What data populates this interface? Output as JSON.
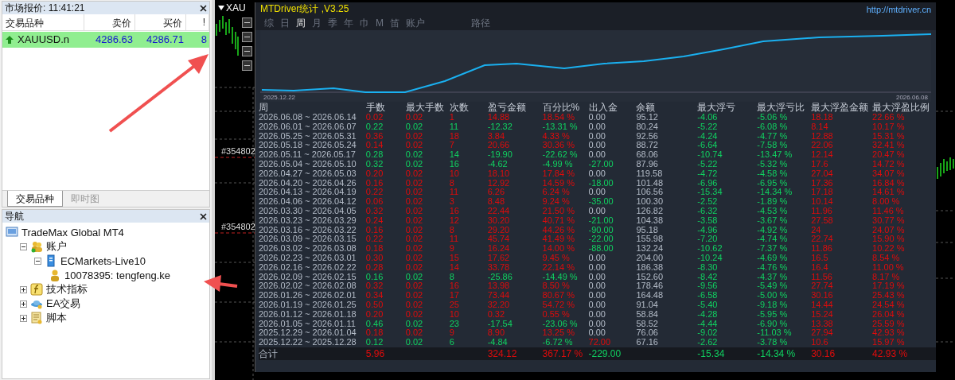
{
  "market_watch": {
    "title": "市场报价: 11:41:21",
    "columns": [
      "交易品种",
      "卖价",
      "买价",
      "!"
    ],
    "rows": [
      {
        "symbol": "XAUUSD.n",
        "bid": "4286.63",
        "ask": "4286.71",
        "spread": "8",
        "selected": true
      }
    ],
    "tabs": [
      {
        "label": "交易品种",
        "selected": true
      },
      {
        "label": "即时图",
        "selected": false
      }
    ]
  },
  "navigator": {
    "title": "导航",
    "tree": [
      {
        "label": "TradeMax Global MT4",
        "kind": "terminal",
        "children": [
          {
            "label": "账户",
            "kind": "accounts",
            "expanded": true,
            "children": [
              {
                "label": "ECMarkets-Live10",
                "kind": "server",
                "expanded": true,
                "children": [
                  {
                    "label": "10078395: tengfeng.ke",
                    "kind": "account"
                  }
                ]
              }
            ]
          },
          {
            "label": "技术指标",
            "kind": "indicators",
            "expanded": false
          },
          {
            "label": "EA交易",
            "kind": "experts",
            "expanded": false
          },
          {
            "label": "脚本",
            "kind": "scripts",
            "expanded": false
          }
        ]
      }
    ]
  },
  "chart": {
    "symbol": "XAU",
    "order_labels": [
      "#354802",
      "#354802"
    ]
  },
  "stats": {
    "title": "MTDriver统计 ,V3.25",
    "link": "http://mtdriver.cn",
    "tabs": [
      {
        "label": "综",
        "selected": false
      },
      {
        "label": "日",
        "selected": false
      },
      {
        "label": "周",
        "selected": true
      },
      {
        "label": "月",
        "selected": false
      },
      {
        "label": "季",
        "selected": false
      },
      {
        "label": "年",
        "selected": false
      },
      {
        "label": "巾",
        "selected": false
      },
      {
        "label": "M",
        "selected": false
      },
      {
        "label": "笛",
        "selected": false
      },
      {
        "label": "账户",
        "selected": false
      },
      {
        "label": "路径",
        "selected": false
      }
    ],
    "equity_start": "2025.12.22",
    "equity_end": "2026.06.08",
    "columns": [
      "周",
      "手数",
      "最大手数",
      "次数",
      "盈亏金额",
      "百分比%",
      "出入金",
      "余额",
      "最大浮亏",
      "最大浮亏比",
      "最大浮盈金额",
      "最大浮盈比例"
    ],
    "rows": [
      {
        "cells": [
          "2026.06.08 ~ 2026.06.14",
          "0.02",
          "0.02",
          "1",
          "14.88",
          "18.54 %",
          "0.00",
          "95.12",
          "-4.06",
          "-5.06 %",
          "18.18",
          "22.66 %"
        ],
        "profit": true,
        "withdrawal": false,
        "deposit": false
      },
      {
        "cells": [
          "2026.06.01 ~ 2026.06.07",
          "0.22",
          "0.02",
          "11",
          "-12.32",
          "-13.31 %",
          "0.00",
          "80.24",
          "-5.22",
          "-6.08 %",
          "8.14",
          "10.17 %"
        ],
        "profit": false,
        "withdrawal": false,
        "deposit": false
      },
      {
        "cells": [
          "2026.05.25 ~ 2026.05.31",
          "0.36",
          "0.02",
          "18",
          "3.84",
          "4.33 %",
          "0.00",
          "92.56",
          "-4.24",
          "-4.77 %",
          "12.88",
          "15.31 %"
        ],
        "profit": true,
        "withdrawal": false,
        "deposit": false
      },
      {
        "cells": [
          "2026.05.18 ~ 2026.05.24",
          "0.14",
          "0.02",
          "7",
          "20.66",
          "30.36 %",
          "0.00",
          "88.72",
          "-6.64",
          "-7.58 %",
          "22.06",
          "32.41 %"
        ],
        "profit": true,
        "withdrawal": false,
        "deposit": false
      },
      {
        "cells": [
          "2026.05.11 ~ 2026.05.17",
          "0.28",
          "0.02",
          "14",
          "-19.90",
          "-22.62 %",
          "0.00",
          "68.06",
          "-10.74",
          "-13.47 %",
          "12.14",
          "20.47 %"
        ],
        "profit": false,
        "withdrawal": false,
        "deposit": false
      },
      {
        "cells": [
          "2026.05.04 ~ 2026.05.10",
          "0.32",
          "0.02",
          "16",
          "-4.62",
          "-4.99 %",
          "-27.00",
          "87.96",
          "-5.22",
          "-5.32 %",
          "17.6",
          "14.72 %"
        ],
        "profit": false,
        "withdrawal": true,
        "deposit": false
      },
      {
        "cells": [
          "2026.04.27 ~ 2026.05.03",
          "0.20",
          "0.02",
          "10",
          "18.10",
          "17.84 %",
          "0.00",
          "119.58",
          "-4.72",
          "-4.58 %",
          "27.04",
          "34.07 %"
        ],
        "profit": true,
        "withdrawal": false,
        "deposit": false
      },
      {
        "cells": [
          "2026.04.20 ~ 2026.04.26",
          "0.16",
          "0.02",
          "8",
          "12.92",
          "14.59 %",
          "-18.00",
          "101.48",
          "-6.96",
          "-6.95 %",
          "17.36",
          "16.84 %"
        ],
        "profit": true,
        "withdrawal": true,
        "deposit": false
      },
      {
        "cells": [
          "2026.04.13 ~ 2026.04.19",
          "0.22",
          "0.02",
          "11",
          "6.26",
          "6.24 %",
          "0.00",
          "106.56",
          "-15.34",
          "-14.34 %",
          "17.18",
          "14.61 %"
        ],
        "profit": true,
        "withdrawal": false,
        "deposit": false
      },
      {
        "cells": [
          "2026.04.06 ~ 2026.04.12",
          "0.06",
          "0.02",
          "3",
          "8.48",
          "9.24 %",
          "-35.00",
          "100.30",
          "-2.52",
          "-1.89 %",
          "10.14",
          "8.00 %"
        ],
        "profit": true,
        "withdrawal": true,
        "deposit": false
      },
      {
        "cells": [
          "2026.03.30 ~ 2026.04.05",
          "0.32",
          "0.02",
          "16",
          "22.44",
          "21.50 %",
          "0.00",
          "126.82",
          "-6.32",
          "-4.53 %",
          "11.96",
          "11.46 %"
        ],
        "profit": true,
        "withdrawal": false,
        "deposit": false
      },
      {
        "cells": [
          "2026.03.23 ~ 2026.03.29",
          "0.24",
          "0.02",
          "12",
          "30.20",
          "40.71 %",
          "-21.00",
          "104.38",
          "-3.58",
          "-3.67 %",
          "27.58",
          "30.77 %"
        ],
        "profit": true,
        "withdrawal": true,
        "deposit": false
      },
      {
        "cells": [
          "2026.03.16 ~ 2026.03.22",
          "0.16",
          "0.02",
          "8",
          "29.20",
          "44.26 %",
          "-90.00",
          "95.18",
          "-4.96",
          "-4.92 %",
          "24",
          "24.07 %"
        ],
        "profit": true,
        "withdrawal": true,
        "deposit": false
      },
      {
        "cells": [
          "2026.03.09 ~ 2026.03.15",
          "0.22",
          "0.02",
          "11",
          "45.74",
          "41.49 %",
          "-22.00",
          "155.98",
          "-7.20",
          "-4.74 %",
          "22.74",
          "15.90 %"
        ],
        "profit": true,
        "withdrawal": true,
        "deposit": false
      },
      {
        "cells": [
          "2026.03.02 ~ 2026.03.08",
          "0.18",
          "0.02",
          "9",
          "16.24",
          "14.00 %",
          "-88.00",
          "132.24",
          "-10.62",
          "-7.37 %",
          "11.86",
          "10.22 %"
        ],
        "profit": true,
        "withdrawal": true,
        "deposit": false
      },
      {
        "cells": [
          "2026.02.23 ~ 2026.03.01",
          "0.30",
          "0.02",
          "15",
          "17.62",
          "9.45 %",
          "0.00",
          "204.00",
          "-10.24",
          "-4.69 %",
          "16.5",
          "8.54 %"
        ],
        "profit": true,
        "withdrawal": false,
        "deposit": false
      },
      {
        "cells": [
          "2026.02.16 ~ 2026.02.22",
          "0.28",
          "0.02",
          "14",
          "33.78",
          "22.14 %",
          "0.00",
          "186.38",
          "-8.30",
          "-4.76 %",
          "16.4",
          "11.00 %"
        ],
        "profit": true,
        "withdrawal": false,
        "deposit": false
      },
      {
        "cells": [
          "2026.02.09 ~ 2026.02.15",
          "0.16",
          "0.02",
          "8",
          "-25.86",
          "-14.49 %",
          "0.00",
          "152.60",
          "-8.42",
          "-4.37 %",
          "11.56",
          "8.17 %"
        ],
        "profit": false,
        "withdrawal": false,
        "deposit": false
      },
      {
        "cells": [
          "2026.02.02 ~ 2026.02.08",
          "0.32",
          "0.02",
          "16",
          "13.98",
          "8.50 %",
          "0.00",
          "178.46",
          "-9.56",
          "-5.49 %",
          "27.74",
          "17.19 %"
        ],
        "profit": true,
        "withdrawal": false,
        "deposit": false
      },
      {
        "cells": [
          "2026.01.26 ~ 2026.02.01",
          "0.34",
          "0.02",
          "17",
          "73.44",
          "80.67 %",
          "0.00",
          "164.48",
          "-6.58",
          "-5.00 %",
          "30.16",
          "25.43 %"
        ],
        "profit": true,
        "withdrawal": false,
        "deposit": false
      },
      {
        "cells": [
          "2026.01.19 ~ 2026.01.25",
          "0.50",
          "0.02",
          "25",
          "32.20",
          "54.72 %",
          "0.00",
          "91.04",
          "-5.40",
          "-9.18 %",
          "14.44",
          "24.54 %"
        ],
        "profit": true,
        "withdrawal": false,
        "deposit": false
      },
      {
        "cells": [
          "2026.01.12 ~ 2026.01.18",
          "0.20",
          "0.02",
          "10",
          "0.32",
          "0.55 %",
          "0.00",
          "58.84",
          "-4.28",
          "-5.95 %",
          "15.24",
          "26.04 %"
        ],
        "profit": true,
        "withdrawal": false,
        "deposit": false
      },
      {
        "cells": [
          "2026.01.05 ~ 2026.01.11",
          "0.46",
          "0.02",
          "23",
          "-17.54",
          "-23.06 %",
          "0.00",
          "58.52",
          "-4.44",
          "-6.90 %",
          "13.38",
          "25.59 %"
        ],
        "profit": false,
        "withdrawal": false,
        "deposit": false
      },
      {
        "cells": [
          "2025.12.29 ~ 2026.01.04",
          "0.18",
          "0.02",
          "9",
          "8.90",
          "13.25 %",
          "0.00",
          "76.06",
          "-9.02",
          "-11.03 %",
          "27.94",
          "42.93 %"
        ],
        "profit": true,
        "withdrawal": false,
        "deposit": false
      },
      {
        "cells": [
          "2025.12.22 ~ 2025.12.28",
          "0.12",
          "0.02",
          "6",
          "-4.84",
          "-6.72 %",
          "72.00",
          "67.16",
          "-2.62",
          "-3.78 %",
          "10.6",
          "15.97 %"
        ],
        "profit": false,
        "withdrawal": false,
        "deposit": true
      }
    ],
    "total": {
      "cells": [
        "合计",
        "5.96",
        "",
        "",
        "324.12",
        "367.17 %",
        "-229.00",
        "",
        "-15.34",
        "-14.34 %",
        "30.16",
        "42.93 %"
      ],
      "profit": true,
      "withdrawal": true,
      "deposit": false
    }
  }
}
